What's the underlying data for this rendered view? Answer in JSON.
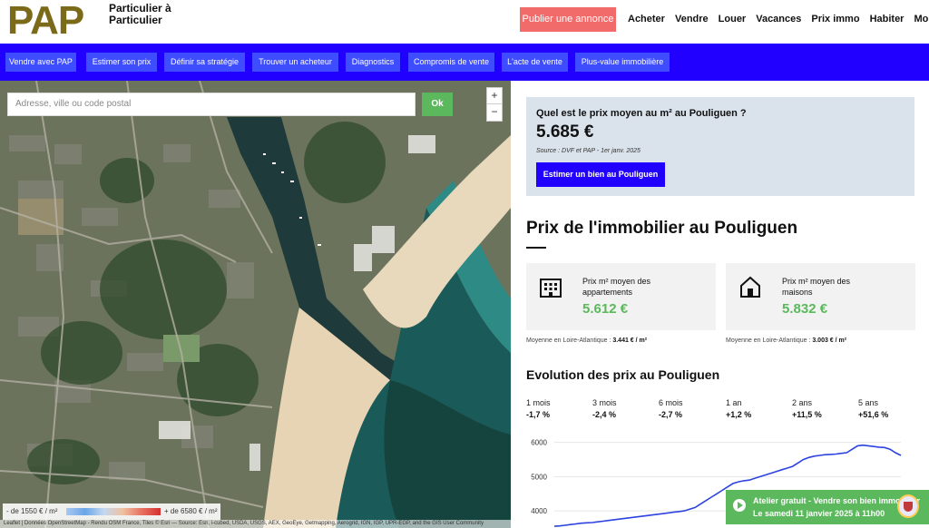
{
  "header": {
    "logo": "PAP",
    "tagline": "Particulier à Particulier",
    "publish_label": "Publier une annonce",
    "nav": [
      "Acheter",
      "Vendre",
      "Louer",
      "Vacances",
      "Prix immo",
      "Habiter",
      "Mon espace"
    ]
  },
  "subnav": [
    "Vendre avec PAP",
    "Estimer son prix",
    "Définir sa stratégie",
    "Trouver un acheteur",
    "Diagnostics",
    "Compromis de vente",
    "L'acte de vente",
    "Plus-value immobilière"
  ],
  "map": {
    "search_placeholder": "Adresse, ville ou code postal",
    "ok_label": "Ok",
    "zoom_in": "+",
    "zoom_out": "−",
    "legend_low": "- de 1550 € / m²",
    "legend_high": "+ de 6580 € / m²",
    "attribution": "Leaflet | Données OpenStreetMap - Rendu OSM France, Tiles © Esri — Source: Esri, i-cubed, USDA, USGS, AEX, GeoEye, Getmapping, Aerogrid, IGN, IGP, UPR-EGP, and the GIS User Community"
  },
  "question_box": {
    "question": "Quel est le prix moyen au m² au Pouliguen ?",
    "price": "5.685 €",
    "source": "Source : DVF et PAP - 1er janv. 2025",
    "button": "Estimer un bien au Pouliguen"
  },
  "section_title": "Prix de l'immobilier au Pouliguen",
  "cards": [
    {
      "title": "Prix m² moyen des appartements",
      "value": "5.612 €",
      "icon": "building-icon",
      "note_prefix": "Moyenne en Loire-Atlantique : ",
      "note_value": "3.441 € / m²"
    },
    {
      "title": "Prix m² moyen des maisons",
      "value": "5.832 €",
      "icon": "house-icon",
      "note_prefix": "Moyenne en Loire-Atlantique : ",
      "note_value": "3.003 € / m²"
    }
  ],
  "evolution": {
    "title": "Evolution des prix au Pouliguen",
    "periods": [
      {
        "label": "1 mois",
        "value": "-1,7 %"
      },
      {
        "label": "3 mois",
        "value": "-2,4 %"
      },
      {
        "label": "6 mois",
        "value": "-2,7 %"
      },
      {
        "label": "1 an",
        "value": "+1,2 %"
      },
      {
        "label": "2 ans",
        "value": "+11,5 %"
      },
      {
        "label": "5 ans",
        "value": "+51,6 %"
      }
    ]
  },
  "chart_data": {
    "type": "line",
    "yticks": [
      "6000",
      "5000",
      "4000"
    ],
    "ylim": [
      3500,
      6150
    ],
    "series": [
      {
        "values": [
          3550,
          3560,
          3580,
          3600,
          3620,
          3640,
          3650,
          3660,
          3680,
          3700,
          3720,
          3740,
          3760,
          3780,
          3800,
          3820,
          3840,
          3860,
          3880,
          3900,
          3920,
          3940,
          3960,
          3980,
          4000,
          4050,
          4100,
          4200,
          4300,
          4400,
          4500,
          4600,
          4700,
          4800,
          4850,
          4880,
          4900,
          4950,
          5000,
          5050,
          5100,
          5150,
          5200,
          5250,
          5300,
          5400,
          5500,
          5560,
          5600,
          5620,
          5640,
          5650,
          5660,
          5680,
          5700,
          5800,
          5900,
          5920,
          5900,
          5880,
          5860,
          5850,
          5800,
          5700,
          5620
        ]
      }
    ],
    "color": "#2d43e0"
  },
  "toast": {
    "line1": "Atelier gratuit - Vendre son bien immobilier",
    "line2": "Le samedi 11 janvier 2025 à 11h00"
  }
}
